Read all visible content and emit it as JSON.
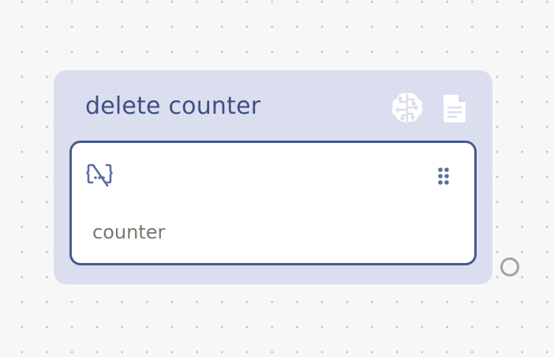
{
  "node": {
    "title": "delete counter",
    "icons": {
      "left": "brain-icon",
      "right": "document-icon"
    },
    "card": {
      "icon": "variable-off-icon",
      "handle": "drag-handle-icon",
      "text": "counter"
    }
  },
  "colors": {
    "canvas": "#f8f7f8",
    "node_background": "#dadeee",
    "title": "#3d5086",
    "card_border": "#465b8c",
    "icon_white": "#ffffff",
    "port": "#a1a1a5"
  }
}
